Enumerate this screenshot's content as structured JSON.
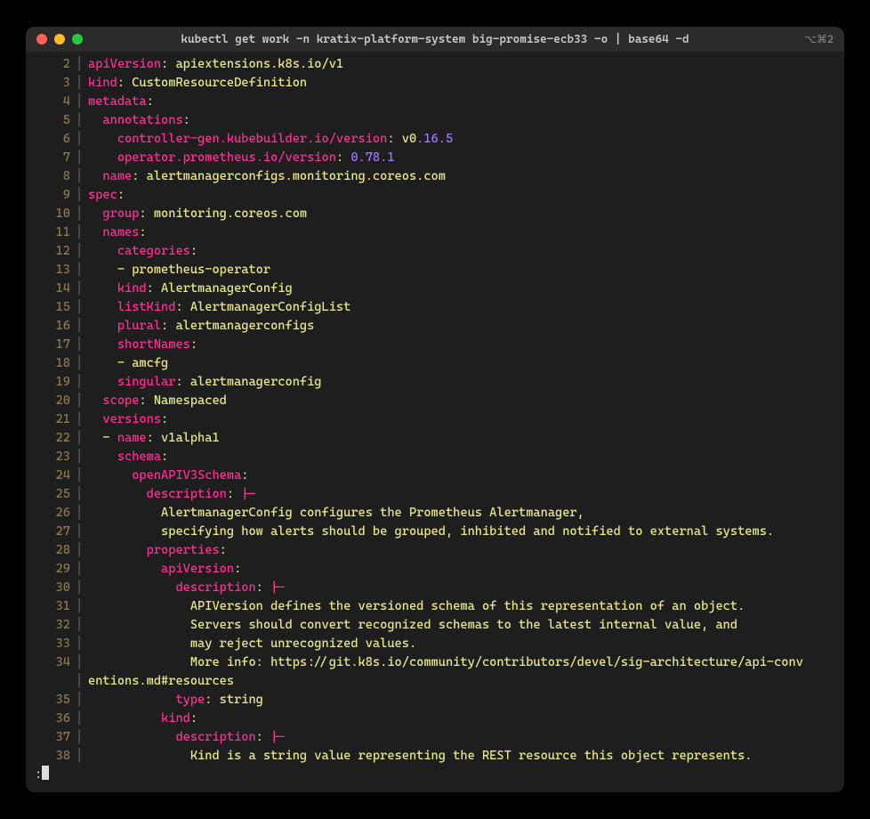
{
  "window": {
    "title": "kubectl get work -n kratix-platform-system big-promise-ecb33 -o | base64 -d",
    "right_indicator": "⌥⌘2"
  },
  "prompt": {
    "prefix": ":"
  },
  "lines": [
    {
      "num": "2",
      "indent": 0,
      "tokens": [
        {
          "c": "k",
          "t": "apiVersion"
        },
        {
          "c": "p",
          "t": ": "
        },
        {
          "c": "s",
          "t": "apiextensions.k8s.io/v1"
        }
      ]
    },
    {
      "num": "3",
      "indent": 0,
      "tokens": [
        {
          "c": "k",
          "t": "kind"
        },
        {
          "c": "p",
          "t": ": "
        },
        {
          "c": "s",
          "t": "CustomResourceDefinition"
        }
      ]
    },
    {
      "num": "4",
      "indent": 0,
      "tokens": [
        {
          "c": "k",
          "t": "metadata"
        },
        {
          "c": "p",
          "t": ":"
        }
      ]
    },
    {
      "num": "5",
      "indent": 1,
      "tokens": [
        {
          "c": "k",
          "t": "annotations"
        },
        {
          "c": "p",
          "t": ":"
        }
      ]
    },
    {
      "num": "6",
      "indent": 2,
      "tokens": [
        {
          "c": "k",
          "t": "controller-gen.kubebuilder.io/version"
        },
        {
          "c": "p",
          "t": ": "
        },
        {
          "c": "s",
          "t": "v0"
        },
        {
          "c": "n",
          "t": ".16.5"
        }
      ]
    },
    {
      "num": "7",
      "indent": 2,
      "tokens": [
        {
          "c": "k",
          "t": "operator.prometheus.io/version"
        },
        {
          "c": "p",
          "t": ": "
        },
        {
          "c": "n",
          "t": "0.78.1"
        }
      ]
    },
    {
      "num": "8",
      "indent": 1,
      "tokens": [
        {
          "c": "k",
          "t": "name"
        },
        {
          "c": "p",
          "t": ": "
        },
        {
          "c": "s",
          "t": "alertmanagerconfigs.monitoring.coreos.com"
        }
      ]
    },
    {
      "num": "9",
      "indent": 0,
      "tokens": [
        {
          "c": "k",
          "t": "spec"
        },
        {
          "c": "p",
          "t": ":"
        }
      ]
    },
    {
      "num": "10",
      "indent": 1,
      "tokens": [
        {
          "c": "k",
          "t": "group"
        },
        {
          "c": "p",
          "t": ": "
        },
        {
          "c": "s",
          "t": "monitoring.coreos.com"
        }
      ]
    },
    {
      "num": "11",
      "indent": 1,
      "tokens": [
        {
          "c": "k",
          "t": "names"
        },
        {
          "c": "p",
          "t": ":"
        }
      ]
    },
    {
      "num": "12",
      "indent": 2,
      "tokens": [
        {
          "c": "k",
          "t": "categories"
        },
        {
          "c": "p",
          "t": ":"
        }
      ]
    },
    {
      "num": "13",
      "indent": 2,
      "tokens": [
        {
          "c": "d",
          "t": "- "
        },
        {
          "c": "s",
          "t": "prometheus-operator"
        }
      ]
    },
    {
      "num": "14",
      "indent": 2,
      "tokens": [
        {
          "c": "k",
          "t": "kind"
        },
        {
          "c": "p",
          "t": ": "
        },
        {
          "c": "s",
          "t": "AlertmanagerConfig"
        }
      ]
    },
    {
      "num": "15",
      "indent": 2,
      "tokens": [
        {
          "c": "k",
          "t": "listKind"
        },
        {
          "c": "p",
          "t": ": "
        },
        {
          "c": "s",
          "t": "AlertmanagerConfigList"
        }
      ]
    },
    {
      "num": "16",
      "indent": 2,
      "tokens": [
        {
          "c": "k",
          "t": "plural"
        },
        {
          "c": "p",
          "t": ": "
        },
        {
          "c": "s",
          "t": "alertmanagerconfigs"
        }
      ]
    },
    {
      "num": "17",
      "indent": 2,
      "tokens": [
        {
          "c": "k",
          "t": "shortNames"
        },
        {
          "c": "p",
          "t": ":"
        }
      ]
    },
    {
      "num": "18",
      "indent": 2,
      "tokens": [
        {
          "c": "d",
          "t": "- "
        },
        {
          "c": "s",
          "t": "amcfg"
        }
      ]
    },
    {
      "num": "19",
      "indent": 2,
      "tokens": [
        {
          "c": "k",
          "t": "singular"
        },
        {
          "c": "p",
          "t": ": "
        },
        {
          "c": "s",
          "t": "alertmanagerconfig"
        }
      ]
    },
    {
      "num": "20",
      "indent": 1,
      "tokens": [
        {
          "c": "k",
          "t": "scope"
        },
        {
          "c": "p",
          "t": ": "
        },
        {
          "c": "s",
          "t": "Namespaced"
        }
      ]
    },
    {
      "num": "21",
      "indent": 1,
      "tokens": [
        {
          "c": "k",
          "t": "versions"
        },
        {
          "c": "p",
          "t": ":"
        }
      ]
    },
    {
      "num": "22",
      "indent": 1,
      "tokens": [
        {
          "c": "d",
          "t": "- "
        },
        {
          "c": "k",
          "t": "name"
        },
        {
          "c": "p",
          "t": ": "
        },
        {
          "c": "s",
          "t": "v1alpha1"
        }
      ]
    },
    {
      "num": "23",
      "indent": 2,
      "tokens": [
        {
          "c": "k",
          "t": "schema"
        },
        {
          "c": "p",
          "t": ":"
        }
      ]
    },
    {
      "num": "24",
      "indent": 3,
      "tokens": [
        {
          "c": "k",
          "t": "openAPIV3Schema"
        },
        {
          "c": "p",
          "t": ":"
        }
      ]
    },
    {
      "num": "25",
      "indent": 4,
      "tokens": [
        {
          "c": "k",
          "t": "description"
        },
        {
          "c": "p",
          "t": ": "
        },
        {
          "c": "pipe",
          "t": "|-"
        }
      ]
    },
    {
      "num": "26",
      "indent": 5,
      "tokens": [
        {
          "c": "s",
          "t": "AlertmanagerConfig configures the Prometheus Alertmanager,"
        }
      ]
    },
    {
      "num": "27",
      "indent": 5,
      "tokens": [
        {
          "c": "s",
          "t": "specifying how alerts should be grouped, inhibited and notified to external systems."
        }
      ]
    },
    {
      "num": "28",
      "indent": 4,
      "tokens": [
        {
          "c": "k",
          "t": "properties"
        },
        {
          "c": "p",
          "t": ":"
        }
      ]
    },
    {
      "num": "29",
      "indent": 5,
      "tokens": [
        {
          "c": "k",
          "t": "apiVersion"
        },
        {
          "c": "p",
          "t": ":"
        }
      ]
    },
    {
      "num": "30",
      "indent": 6,
      "tokens": [
        {
          "c": "k",
          "t": "description"
        },
        {
          "c": "p",
          "t": ": "
        },
        {
          "c": "pipe",
          "t": "|-"
        }
      ]
    },
    {
      "num": "31",
      "indent": 7,
      "tokens": [
        {
          "c": "s",
          "t": "APIVersion defines the versioned schema of this representation of an object."
        }
      ]
    },
    {
      "num": "32",
      "indent": 7,
      "tokens": [
        {
          "c": "s",
          "t": "Servers should convert recognized schemas to the latest internal value, and"
        }
      ]
    },
    {
      "num": "33",
      "indent": 7,
      "tokens": [
        {
          "c": "s",
          "t": "may reject unrecognized values."
        }
      ]
    },
    {
      "num": "34",
      "indent": 7,
      "tokens": [
        {
          "c": "s",
          "t": "More info: https://git.k8s.io/community/contributors/devel/sig-architecture/api-conv"
        }
      ],
      "wrap": "entions.md#resources"
    },
    {
      "num": "35",
      "indent": 6,
      "tokens": [
        {
          "c": "k",
          "t": "type"
        },
        {
          "c": "p",
          "t": ": "
        },
        {
          "c": "s",
          "t": "string"
        }
      ]
    },
    {
      "num": "36",
      "indent": 5,
      "tokens": [
        {
          "c": "k",
          "t": "kind"
        },
        {
          "c": "p",
          "t": ":"
        }
      ]
    },
    {
      "num": "37",
      "indent": 6,
      "tokens": [
        {
          "c": "k",
          "t": "description"
        },
        {
          "c": "p",
          "t": ": "
        },
        {
          "c": "pipe",
          "t": "|-"
        }
      ]
    },
    {
      "num": "38",
      "indent": 7,
      "tokens": [
        {
          "c": "s",
          "t": "Kind is a string value representing the REST resource this object represents."
        }
      ]
    }
  ]
}
